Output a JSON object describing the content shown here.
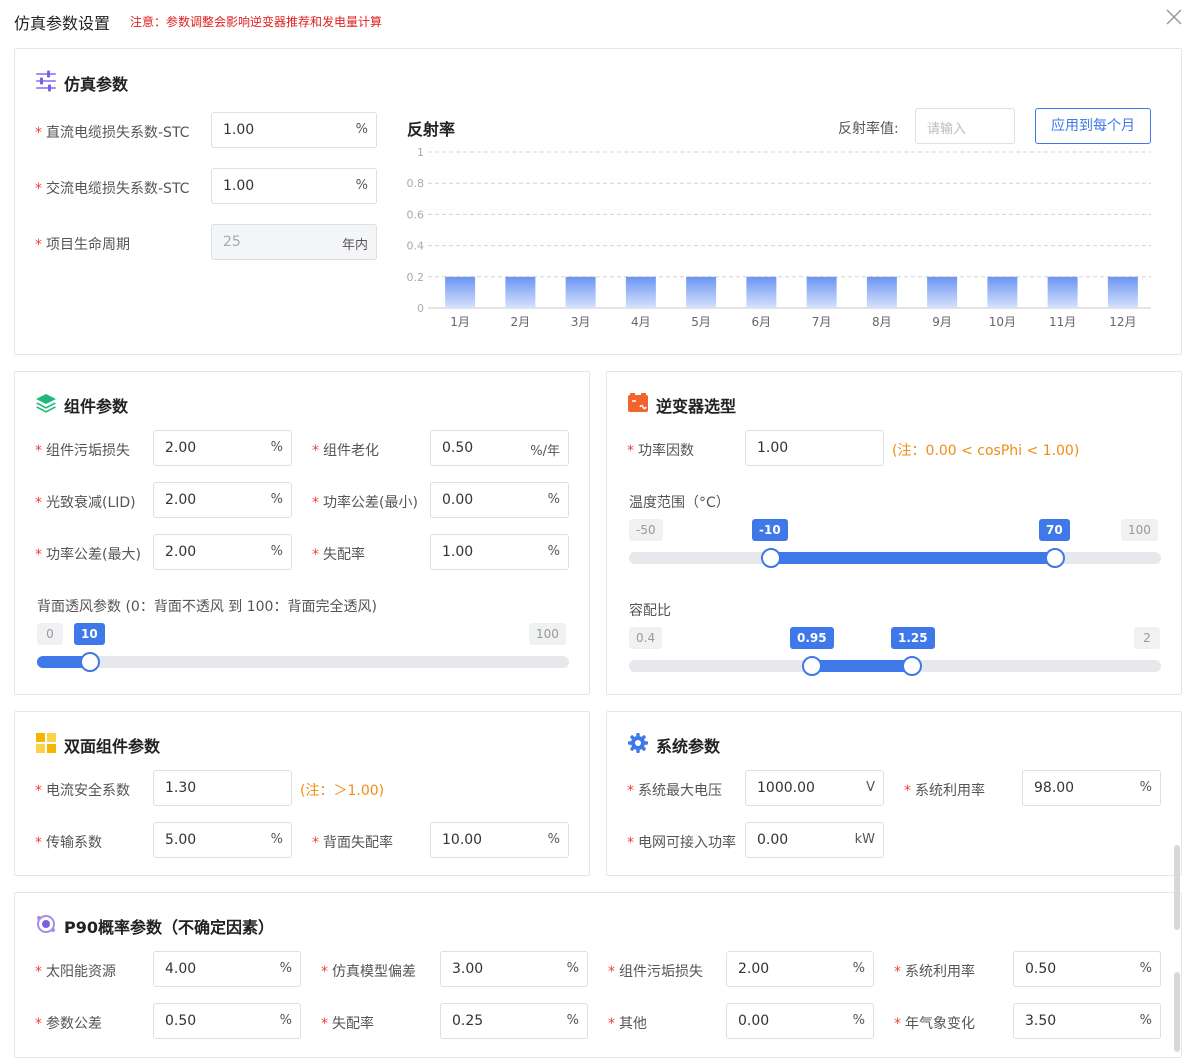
{
  "dialog": {
    "title": "仿真参数设置",
    "warning": "注意：参数调整会影响逆变器推荐和发电量计算"
  },
  "sim_params": {
    "title": "仿真参数",
    "fields": [
      {
        "label": "直流电缆损失系数-STC",
        "value": "1.00",
        "unit": "%"
      },
      {
        "label": "交流电缆损失系数-STC",
        "value": "1.00",
        "unit": "%"
      },
      {
        "label": "项目生命周期",
        "value": "25",
        "unit": "年内"
      }
    ],
    "reflect_title": "反射率",
    "reflect_value_label": "反射率值:",
    "reflect_placeholder": "请输入",
    "apply_button": "应用到每个月"
  },
  "chart_data": {
    "type": "bar",
    "title": "反射率",
    "categories": [
      "1月",
      "2月",
      "3月",
      "4月",
      "5月",
      "6月",
      "7月",
      "8月",
      "9月",
      "10月",
      "11月",
      "12月"
    ],
    "values": [
      0.2,
      0.2,
      0.2,
      0.2,
      0.2,
      0.2,
      0.2,
      0.2,
      0.2,
      0.2,
      0.2,
      0.2
    ],
    "ylim": [
      0,
      1
    ],
    "yticks": [
      "1",
      "0.8",
      "0.6",
      "0.4",
      "0.2",
      "0"
    ],
    "grid": true,
    "bar_color_top": "#6b95f2",
    "bar_color_bottom": "#d6e2fc"
  },
  "module_params": {
    "title": "组件参数",
    "fields": [
      {
        "label": "组件污垢损失",
        "value": "2.00",
        "unit": "%"
      },
      {
        "label": "组件老化",
        "value": "0.50",
        "unit": "%/年"
      },
      {
        "label": "光致衰减(LID)",
        "value": "2.00",
        "unit": "%"
      },
      {
        "label": "功率公差(最小)",
        "value": "0.00",
        "unit": "%"
      },
      {
        "label": "功率公差(最大)",
        "value": "2.00",
        "unit": "%"
      },
      {
        "label": "失配率",
        "value": "1.00",
        "unit": "%"
      }
    ],
    "vent_label": "背面透风参数 (0：背面不透风 到 100：背面完全透风)",
    "vent_min": "0",
    "vent_value": "10",
    "vent_max": "100",
    "vent_fraction": 0.1
  },
  "inverter": {
    "title": "逆变器选型",
    "pf_label": "功率因数",
    "pf_value": "1.00",
    "pf_note": "(注：0.00 < cosPhi < 1.00)",
    "temp_label": "温度范围（°C）",
    "temp_min": "-50",
    "temp_low": "-10",
    "temp_high": "70",
    "temp_max": "100",
    "temp_low_fraction": 0.2667,
    "temp_high_fraction": 0.8,
    "ratio_label": "容配比",
    "ratio_min": "0.4",
    "ratio_low": "0.95",
    "ratio_high": "1.25",
    "ratio_max": "2",
    "ratio_low_fraction": 0.3438,
    "ratio_high_fraction": 0.5313
  },
  "bifacial": {
    "title": "双面组件参数",
    "current_label": "电流安全系数",
    "current_value": "1.30",
    "current_note": "(注：＞1.00)",
    "trans_label": "传输系数",
    "trans_value": "5.00",
    "trans_unit": "%",
    "mismatch_label": "背面失配率",
    "mismatch_value": "10.00",
    "mismatch_unit": "%"
  },
  "system": {
    "title": "系统参数",
    "maxv_label": "系统最大电压",
    "maxv_value": "1000.00",
    "maxv_unit": "V",
    "util_label": "系统利用率",
    "util_value": "98.00",
    "util_unit": "%",
    "grid_label": "电网可接入功率",
    "grid_value": "0.00",
    "grid_unit": "kW"
  },
  "p90": {
    "title": "P90概率参数（不确定因素）",
    "fields": [
      {
        "label": "太阳能资源",
        "value": "4.00",
        "unit": "%"
      },
      {
        "label": "仿真模型偏差",
        "value": "3.00",
        "unit": "%"
      },
      {
        "label": "组件污垢损失",
        "value": "2.00",
        "unit": "%"
      },
      {
        "label": "系统利用率",
        "value": "0.50",
        "unit": "%"
      },
      {
        "label": "参数公差",
        "value": "0.50",
        "unit": "%"
      },
      {
        "label": "失配率",
        "value": "0.25",
        "unit": "%"
      },
      {
        "label": "其他",
        "value": "0.00",
        "unit": "%"
      },
      {
        "label": "年气象变化",
        "value": "3.50",
        "unit": "%"
      }
    ]
  },
  "icons": {
    "close": "close-icon",
    "sim": "sliders-icon",
    "module": "layers-icon",
    "inverter": "inverter-icon",
    "bifacial": "grid-icon",
    "system": "gear-icon",
    "p90": "probability-icon"
  },
  "colors": {
    "accent": "#3f78e8",
    "required": "#f04040",
    "warning": "#e02020",
    "note": "#f08c14"
  }
}
